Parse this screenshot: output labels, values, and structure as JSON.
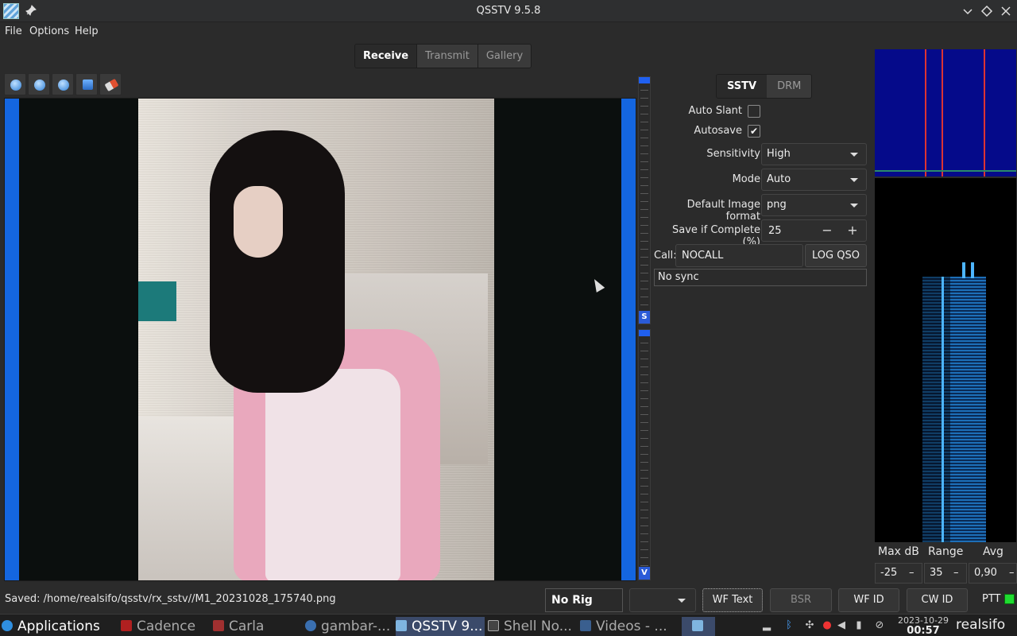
{
  "window": {
    "title": "QSSTV 9.5.8"
  },
  "menu": {
    "items": [
      "File",
      "Options",
      "Help"
    ]
  },
  "tabs": {
    "items": [
      "Receive",
      "Transmit",
      "Gallery"
    ],
    "active": "Receive"
  },
  "mode_tabs": {
    "items": [
      "SSTV",
      "DRM"
    ],
    "active": "SSTV"
  },
  "slider": {
    "marker_s": "S",
    "marker_v": "V"
  },
  "controls": {
    "auto_slant_label": "Auto Slant",
    "auto_slant_checked": false,
    "autosave_label": "Autosave",
    "autosave_checked": true,
    "autosave_mark": "✔",
    "sensitivity_label": "Sensitivity",
    "sensitivity_value": "High",
    "mode_label": "Mode",
    "mode_value": "Auto",
    "image_format_label": "Default Image format",
    "image_format_value": "png",
    "save_complete_label": "Save if Complete (%)",
    "save_complete_value": "25",
    "call_label": "Call:",
    "call_value": "NOCALL",
    "log_qso_label": "LOG QSO",
    "sync_status": "No sync"
  },
  "waterfall": {
    "max_db_label": "Max dB",
    "range_label": "Range",
    "avg_label": "Avg",
    "max_db_value": "-25",
    "range_value": "35",
    "avg_value": "0,90",
    "minus": "–"
  },
  "status": {
    "saved_text": "Saved: /home/realsifo/qsstv/rx_sstv//M1_20231028_175740.png",
    "rig": "No Rig",
    "rig_select": "",
    "buttons": [
      "WF Text",
      "BSR",
      "WF ID",
      "CW ID"
    ],
    "ptt_label": "PTT",
    "ptt_color": "#1fdc30"
  },
  "taskbar": {
    "applications_label": "Applications",
    "tasks": [
      "Cadence",
      "Carla",
      "gambar-...",
      "QSSTV 9...",
      "Shell No...",
      "Videos - ..."
    ],
    "date": "2023-10-29",
    "time": "00:57",
    "user": "realsifo"
  },
  "colors": {
    "accent_blue": "#1466e0",
    "spectrum_bg": "#050a8a",
    "marker_red": "#d33333"
  }
}
